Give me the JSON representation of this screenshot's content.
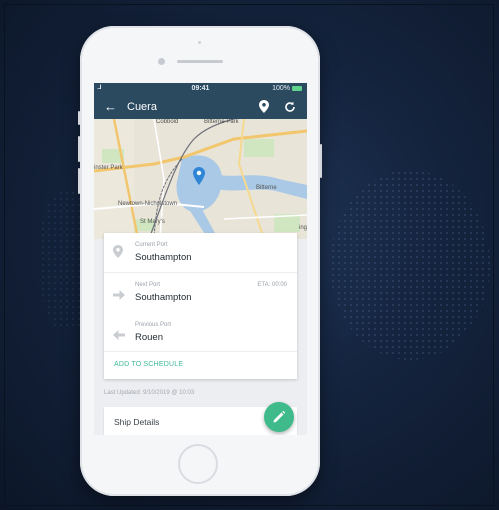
{
  "statusbar": {
    "signal": "....ll",
    "time": "09:41",
    "battery": "100%"
  },
  "appbar": {
    "title": "Cuera"
  },
  "map": {
    "labels": [
      "Cobbold",
      "Bitterne Park",
      "inster Park",
      "Bitterne",
      "Newtown-Nicholstown",
      "St Mary's",
      "ing"
    ]
  },
  "ports": {
    "current": {
      "label": "Current Port",
      "value": "Southampton"
    },
    "next": {
      "label": "Next Port",
      "value": "Southampton",
      "eta": "ETA: 00:00"
    },
    "previous": {
      "label": "Previous Port",
      "value": "Rouen"
    },
    "add_link": "ADD TO SCHEDULE"
  },
  "last_updated": "Last Updated: 9/10/2019 @ 10:03",
  "details": {
    "label": "Ship Details"
  },
  "colors": {
    "appbar": "#2b4a60",
    "accent": "#3fba8a"
  }
}
